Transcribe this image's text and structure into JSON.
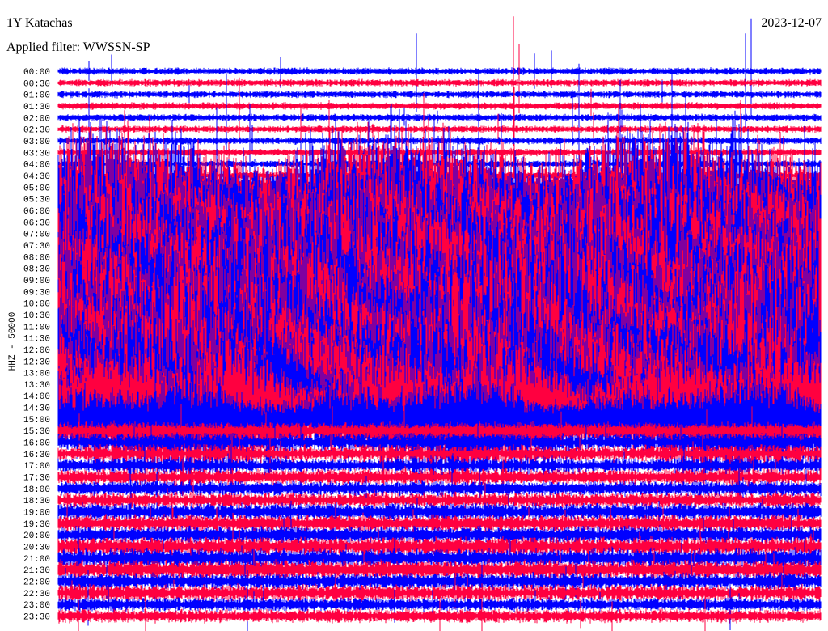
{
  "header": {
    "station": "1Y Katachas",
    "filter": "Applied filter: WWSSN-SP",
    "date": "2023-12-07"
  },
  "chart_data": {
    "type": "line",
    "subtype": "helicorder",
    "title": "1Y Katachas",
    "ylabel": "HHZ - 50000",
    "colors": [
      "#0000ff",
      "#ff0040"
    ],
    "row_labels": [
      "00:00",
      "00:30",
      "01:00",
      "01:30",
      "02:00",
      "02:30",
      "03:00",
      "03:30",
      "04:00",
      "04:30",
      "05:00",
      "05:30",
      "06:00",
      "06:30",
      "07:00",
      "07:30",
      "08:00",
      "08:30",
      "09:00",
      "09:30",
      "10:00",
      "10:30",
      "11:00",
      "11:30",
      "12:00",
      "12:30",
      "13:00",
      "13:30",
      "14:00",
      "14:30",
      "15:00",
      "15:30",
      "16:00",
      "16:30",
      "17:00",
      "17:30",
      "18:00",
      "18:30",
      "19:00",
      "19:30",
      "20:00",
      "20:30",
      "21:00",
      "21:30",
      "22:00",
      "22:30",
      "23:00",
      "23:30"
    ],
    "relative_amplitude": [
      0.03,
      0.04,
      0.04,
      0.05,
      0.05,
      0.06,
      0.06,
      0.08,
      0.1,
      0.15,
      0.35,
      0.6,
      0.8,
      0.9,
      1,
      1,
      1,
      1,
      1,
      1,
      1,
      1,
      1,
      1,
      1,
      1,
      1,
      1,
      0.9,
      0.7,
      0.4,
      0.25,
      0.2,
      0.2,
      0.2,
      0.22,
      0.22,
      0.22,
      0.25,
      0.25,
      0.25,
      0.28,
      0.28,
      0.28,
      0.25,
      0.25,
      0.2,
      0.2
    ]
  }
}
